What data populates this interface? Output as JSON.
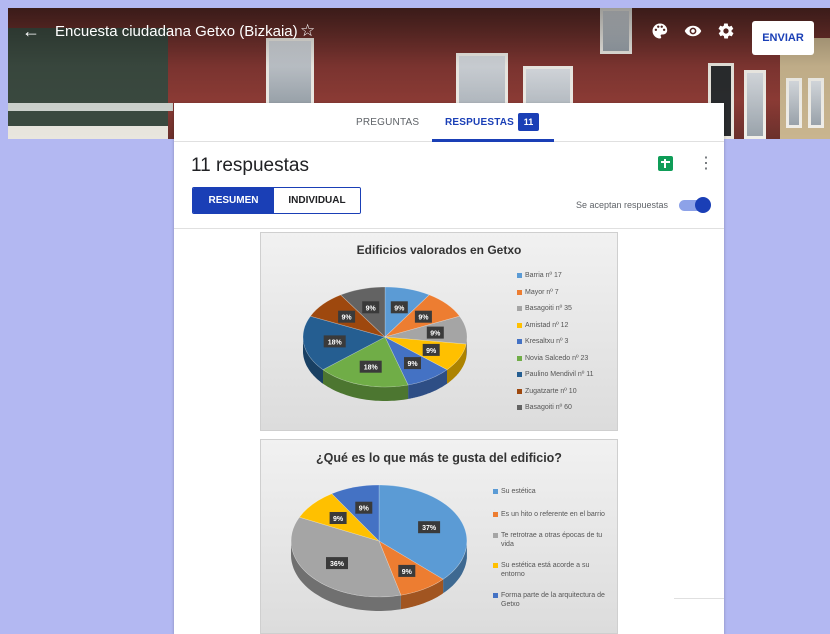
{
  "header": {
    "title": "Encuesta ciudadana Getxo (Bizkaia)",
    "send_label": "ENVIAR",
    "icons": [
      "back-arrow-icon",
      "star-icon",
      "palette-icon",
      "eye-icon",
      "gear-icon"
    ]
  },
  "tabs": {
    "questions_label": "PREGUNTAS",
    "responses_label": "RESPUESTAS",
    "responses_count": "11"
  },
  "summary": {
    "title": "11 respuestas",
    "summary_label": "RESUMEN",
    "individual_label": "INDIVIDUAL",
    "accepting_label": "Se aceptan respuestas",
    "accepting": true
  },
  "colors": {
    "accent": "#1a3fb6",
    "background": "#b3b8f2",
    "sheets": "#0f9d58"
  },
  "chart_data": [
    {
      "type": "pie",
      "title": "Edificios valorados en Getxo",
      "categories": [
        "Barria nº 17",
        "Mayor nº 7",
        "Basagoiti nº 35",
        "Amistad nº 12",
        "Kresaltxu nº 3",
        "Novia Salcedo nº 23",
        "Paulino Mendivil nº 11",
        "Zugatzarte nº 10",
        "Basagoiti nº 60"
      ],
      "values": [
        9,
        9,
        9,
        9,
        9,
        18,
        18,
        9,
        9
      ],
      "labels": [
        "9%",
        "9%",
        "9%",
        "9%",
        "9%",
        "18%",
        "18%",
        "9%",
        "9%"
      ],
      "colors": [
        "#5b9bd5",
        "#ed7d31",
        "#a5a5a5",
        "#ffc000",
        "#4472c4",
        "#70ad47",
        "#255e91",
        "#9e480e",
        "#636363"
      ],
      "legend": "right"
    },
    {
      "type": "pie",
      "title": "¿Qué es lo que más te gusta del edificio?",
      "categories": [
        "Su estética",
        "Es un hito o referente en el barrio",
        "Te retrotrae a otras épocas de tu vida",
        "Su estética está acorde a su entorno",
        "Forma parte de la arquitectura de Getxo"
      ],
      "values": [
        37,
        9,
        36,
        9,
        9
      ],
      "labels": [
        "37%",
        "9%",
        "36%",
        "9%",
        "9%"
      ],
      "colors": [
        "#5b9bd5",
        "#ed7d31",
        "#a5a5a5",
        "#ffc000",
        "#4472c4"
      ],
      "legend": "right"
    }
  ]
}
